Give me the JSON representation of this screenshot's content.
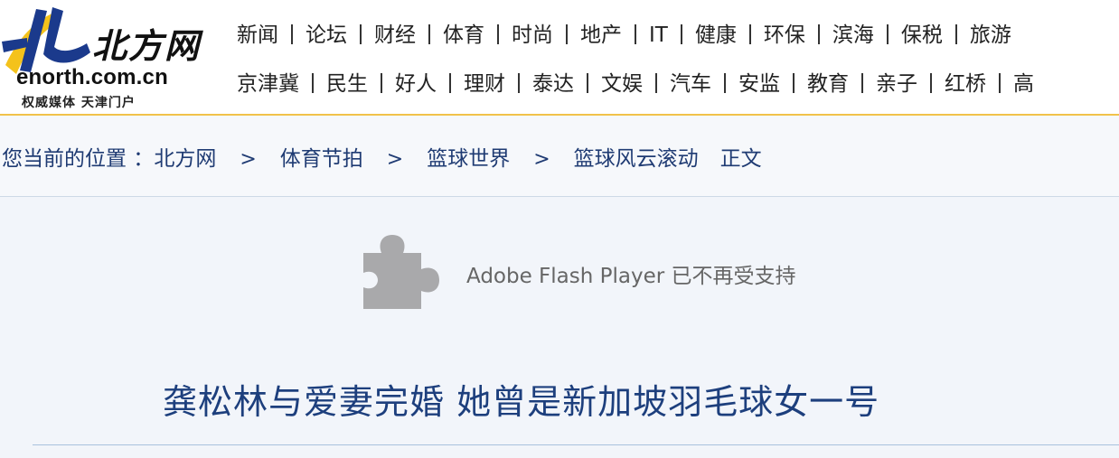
{
  "header": {
    "logo_cn": "北方网",
    "logo_domain": "enorth.com.cn",
    "logo_slogan": "权威媒体  天津门户",
    "nav_row1": [
      "新闻",
      "论坛",
      "财经",
      "体育",
      "时尚",
      "地产",
      "IT",
      "健康",
      "环保",
      "滨海",
      "保税",
      "旅游"
    ],
    "nav_row2": [
      "京津冀",
      "民生",
      "好人",
      "理财",
      "泰达",
      "文娱",
      "汽车",
      "安监",
      "教育",
      "亲子",
      "红桥",
      "高"
    ]
  },
  "breadcrumb": {
    "prefix": "您当前的位置 ：",
    "items": [
      "北方网",
      "体育节拍",
      "篮球世界",
      "篮球风云滚动"
    ],
    "separator": ">",
    "current": "正文"
  },
  "plugin": {
    "message": "Adobe Flash Player 已不再受支持",
    "icon": "puzzle-piece-icon"
  },
  "article": {
    "headline": "龚松林与爱妻完婚  她曾是新加坡羽毛球女一号"
  },
  "colors": {
    "accent_line": "#f1c24a",
    "link": "#1f3b73",
    "headline": "#1d3f7d",
    "logo_blue": "#1b3a8c",
    "logo_yellow": "#f4c21b"
  }
}
